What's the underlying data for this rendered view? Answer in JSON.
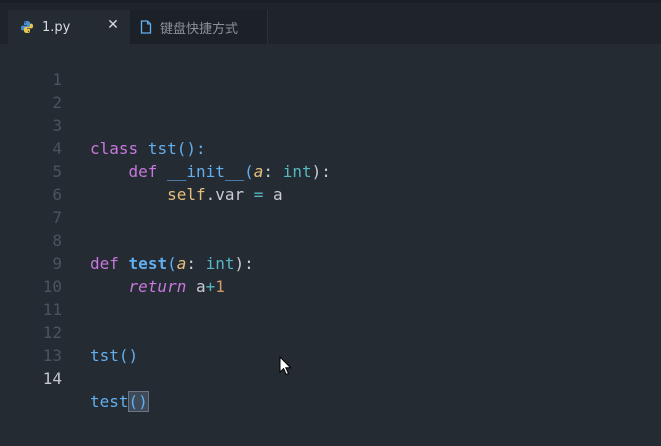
{
  "tabs": [
    {
      "label": "1.py",
      "icon": "python-icon",
      "active": true,
      "close_glyph": "✕"
    },
    {
      "label": "键盘快捷方式",
      "icon": "file-icon",
      "active": false
    }
  ],
  "editor": {
    "line_numbers": [
      "1",
      "2",
      "3",
      "4",
      "5",
      "6",
      "7",
      "8",
      "9",
      "10",
      "11",
      "12",
      "13",
      "14"
    ],
    "current_line": "14",
    "tokens": {
      "l3": {
        "kw": "class",
        "sp": " ",
        "name": "tst",
        "rest": "():"
      },
      "l4": {
        "indent": "    ",
        "kw": "def",
        "sp": " ",
        "name": "__init__",
        "open": "(",
        "param": "a",
        "colon": ": ",
        "type": "int",
        "close": "):"
      },
      "l5": {
        "indent": "        ",
        "self": "self",
        "attr": ".var ",
        "op": "=",
        "val": " a"
      },
      "l8": {
        "kw": "def",
        "sp": " ",
        "name": "test",
        "open": "(",
        "param": "a",
        "colon": ": ",
        "type": "int",
        "close": "):"
      },
      "l9": {
        "indent": "    ",
        "ret": "return",
        "sp": " ",
        "var": "a",
        "op": "+",
        "num": "1"
      },
      "l12": {
        "name": "tst",
        "rest": "()"
      },
      "l14": {
        "name": "test",
        "paren": "()"
      }
    }
  },
  "colors": {
    "background": "#252b33",
    "tabbar": "#1f242b",
    "keyword": "#c678dd",
    "function": "#61afef",
    "parameter": "#e5c07b",
    "type": "#56b6c2",
    "number": "#d19a66"
  }
}
